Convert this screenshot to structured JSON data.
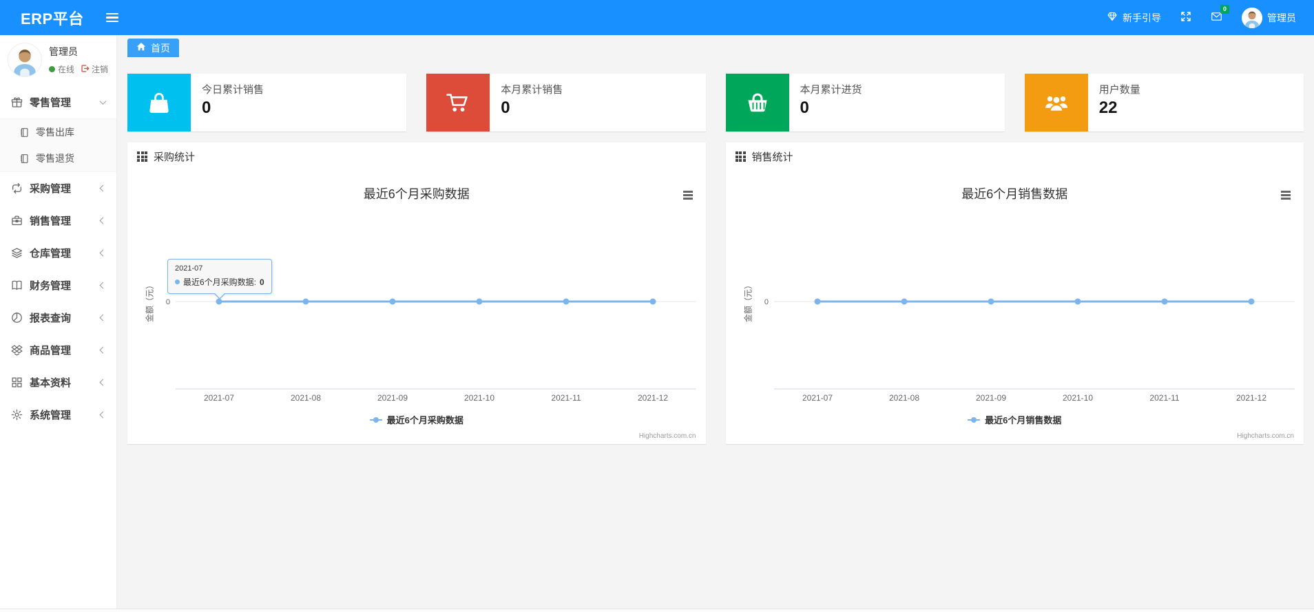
{
  "header": {
    "logo": "ERP平台",
    "guide_label": "新手引导",
    "messages_badge": "0",
    "username": "管理员"
  },
  "sidebar": {
    "user": {
      "name": "管理员",
      "online_label": "在线",
      "logout_label": "注销"
    },
    "menu": [
      {
        "label": "零售管理",
        "icon": "gift-icon",
        "expanded": true,
        "children": [
          "零售出库",
          "零售退货"
        ]
      },
      {
        "label": "采购管理",
        "icon": "repeat-icon",
        "expanded": false
      },
      {
        "label": "销售管理",
        "icon": "briefcase-icon",
        "expanded": false
      },
      {
        "label": "仓库管理",
        "icon": "layers-icon",
        "expanded": false
      },
      {
        "label": "财务管理",
        "icon": "book-open-icon",
        "expanded": false
      },
      {
        "label": "报表查询",
        "icon": "pie-chart-icon",
        "expanded": false
      },
      {
        "label": "商品管理",
        "icon": "dropbox-icon",
        "expanded": false
      },
      {
        "label": "基本资料",
        "icon": "grid-icon",
        "expanded": false
      },
      {
        "label": "系统管理",
        "icon": "gear-icon",
        "expanded": false
      }
    ]
  },
  "tabs": {
    "home": "首页"
  },
  "cards": [
    {
      "label": "今日累计销售",
      "value": "0",
      "color": "#00c0ef",
      "icon": "shopping-bag-icon"
    },
    {
      "label": "本月累计销售",
      "value": "0",
      "color": "#dd4b39",
      "icon": "shopping-cart-icon"
    },
    {
      "label": "本月累计进货",
      "value": "0",
      "color": "#00a65a",
      "icon": "shopping-basket-icon"
    },
    {
      "label": "用户数量",
      "value": "22",
      "color": "#f39c12",
      "icon": "users-icon"
    }
  ],
  "panels": [
    {
      "title": "采购统计"
    },
    {
      "title": "销售统计"
    }
  ],
  "chart_data": [
    {
      "type": "line",
      "title": "最近6个月采购数据",
      "x": [
        "2021-07",
        "2021-08",
        "2021-09",
        "2021-10",
        "2021-11",
        "2021-12"
      ],
      "series": [
        {
          "name": "最近6个月采购数据",
          "values": [
            0,
            0,
            0,
            0,
            0,
            0
          ],
          "color": "#7cb5ec"
        }
      ],
      "ylabel": "金额（元）",
      "yticks": [
        "0"
      ],
      "grid": true,
      "legend_position": "bottom",
      "credits": "Highcharts.com.cn",
      "tooltip": {
        "visible": true,
        "header": "2021-07",
        "label": "最近6个月采购数据:",
        "value": "0"
      }
    },
    {
      "type": "line",
      "title": "最近6个月销售数据",
      "x": [
        "2021-07",
        "2021-08",
        "2021-09",
        "2021-10",
        "2021-11",
        "2021-12"
      ],
      "series": [
        {
          "name": "最近6个月销售数据",
          "values": [
            0,
            0,
            0,
            0,
            0,
            0
          ],
          "color": "#7cb5ec"
        }
      ],
      "ylabel": "金额（元）",
      "yticks": [
        "0"
      ],
      "grid": true,
      "legend_position": "bottom",
      "credits": "Highcharts.com.cn",
      "tooltip": {
        "visible": false
      }
    }
  ]
}
